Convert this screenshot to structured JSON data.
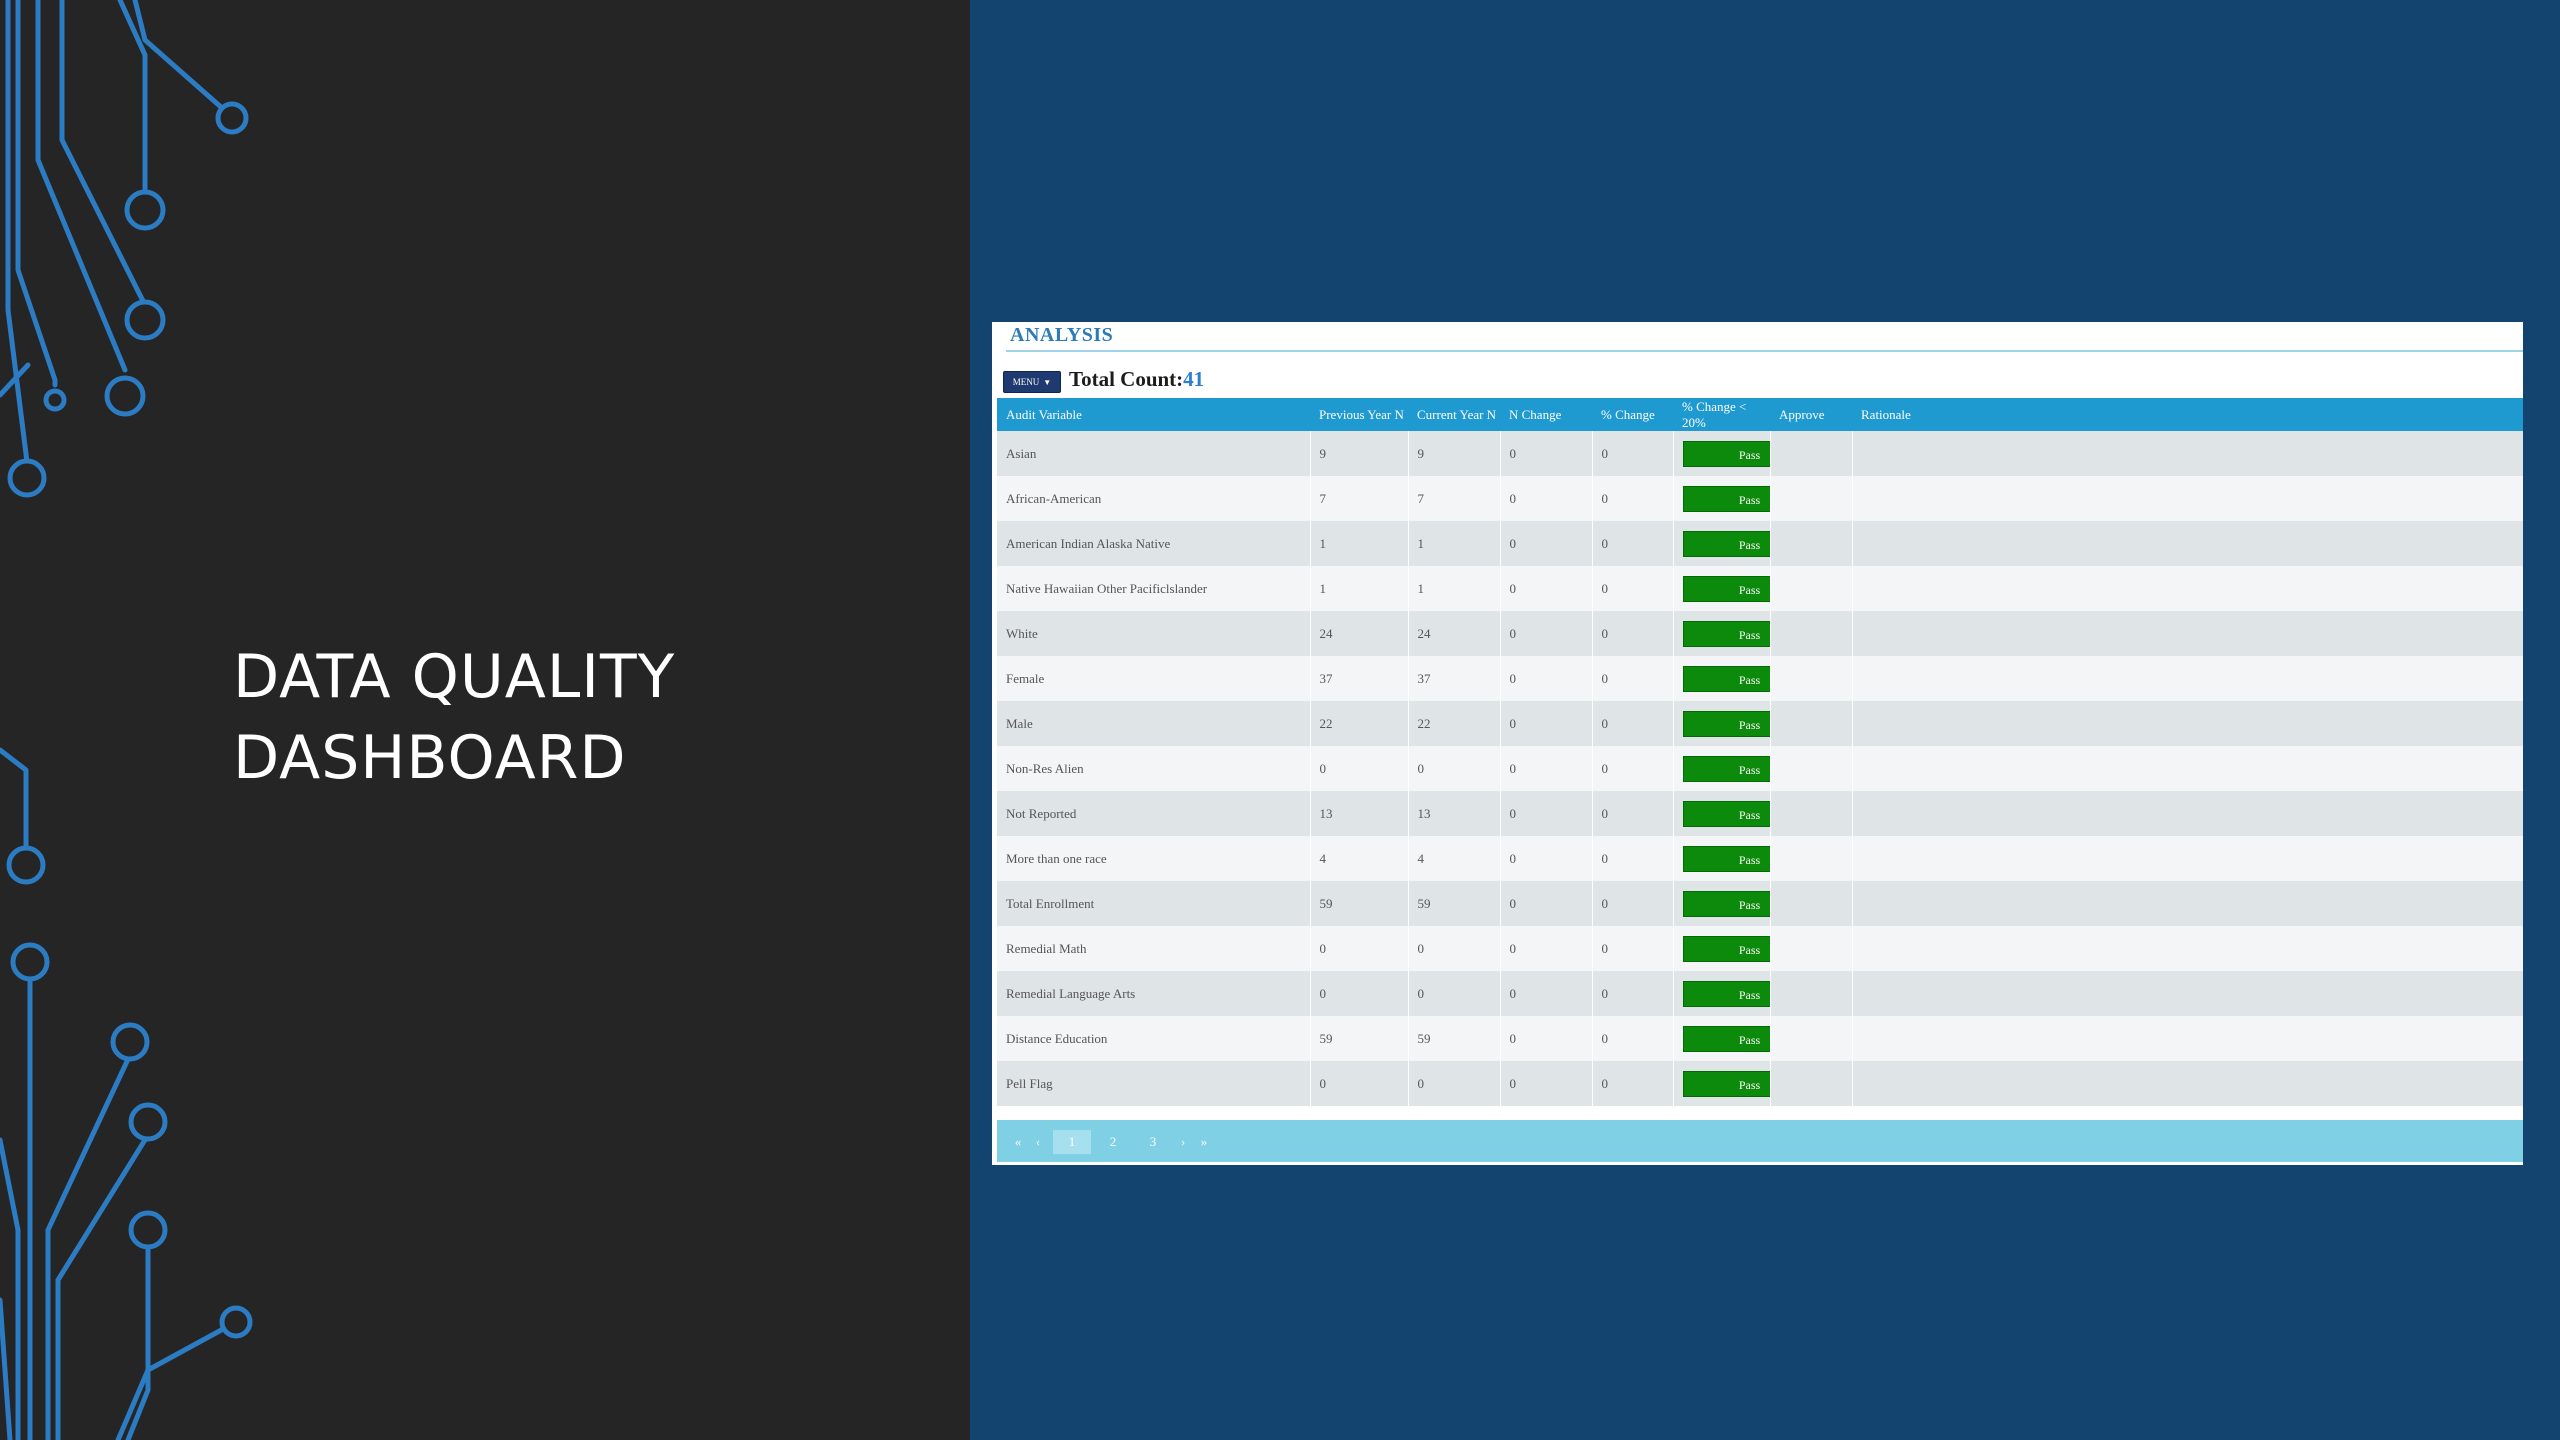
{
  "slide": {
    "title_line1": "DATA QUALITY",
    "title_line2": "DASHBOARD"
  },
  "colors": {
    "left_bg": "#252525",
    "right_bg": "#134470",
    "circuit": "#2c7cc4",
    "table_header": "#1f9ad0",
    "pass": "#0b8a0b",
    "pager": "#7fd0e4"
  },
  "panel": {
    "header": "ANALYSIS",
    "menu_label": "MENU",
    "total_count_label": "Total Count:",
    "total_count_value": "41"
  },
  "table": {
    "columns": [
      "Audit Variable",
      "Previous Year N",
      "Current Year N",
      "N Change",
      "% Change",
      "% Change < 20%",
      "Approve",
      "Rationale"
    ],
    "rows": [
      {
        "variable": "Asian",
        "prev": "9",
        "curr": "9",
        "n_change": "0",
        "pct_change": "0",
        "status": "Pass",
        "approve": "",
        "rationale": ""
      },
      {
        "variable": "African-American",
        "prev": "7",
        "curr": "7",
        "n_change": "0",
        "pct_change": "0",
        "status": "Pass",
        "approve": "",
        "rationale": ""
      },
      {
        "variable": "American Indian Alaska Native",
        "prev": "1",
        "curr": "1",
        "n_change": "0",
        "pct_change": "0",
        "status": "Pass",
        "approve": "",
        "rationale": ""
      },
      {
        "variable": "Native Hawaiian Other Pacificlslander",
        "prev": "1",
        "curr": "1",
        "n_change": "0",
        "pct_change": "0",
        "status": "Pass",
        "approve": "",
        "rationale": ""
      },
      {
        "variable": "White",
        "prev": "24",
        "curr": "24",
        "n_change": "0",
        "pct_change": "0",
        "status": "Pass",
        "approve": "",
        "rationale": ""
      },
      {
        "variable": "Female",
        "prev": "37",
        "curr": "37",
        "n_change": "0",
        "pct_change": "0",
        "status": "Pass",
        "approve": "",
        "rationale": ""
      },
      {
        "variable": "Male",
        "prev": "22",
        "curr": "22",
        "n_change": "0",
        "pct_change": "0",
        "status": "Pass",
        "approve": "",
        "rationale": ""
      },
      {
        "variable": "Non-Res Alien",
        "prev": "0",
        "curr": "0",
        "n_change": "0",
        "pct_change": "0",
        "status": "Pass",
        "approve": "",
        "rationale": ""
      },
      {
        "variable": "Not Reported",
        "prev": "13",
        "curr": "13",
        "n_change": "0",
        "pct_change": "0",
        "status": "Pass",
        "approve": "",
        "rationale": ""
      },
      {
        "variable": "More than one race",
        "prev": "4",
        "curr": "4",
        "n_change": "0",
        "pct_change": "0",
        "status": "Pass",
        "approve": "",
        "rationale": ""
      },
      {
        "variable": "Total Enrollment",
        "prev": "59",
        "curr": "59",
        "n_change": "0",
        "pct_change": "0",
        "status": "Pass",
        "approve": "",
        "rationale": ""
      },
      {
        "variable": "Remedial Math",
        "prev": "0",
        "curr": "0",
        "n_change": "0",
        "pct_change": "0",
        "status": "Pass",
        "approve": "",
        "rationale": ""
      },
      {
        "variable": "Remedial Language Arts",
        "prev": "0",
        "curr": "0",
        "n_change": "0",
        "pct_change": "0",
        "status": "Pass",
        "approve": "",
        "rationale": ""
      },
      {
        "variable": "Distance Education",
        "prev": "59",
        "curr": "59",
        "n_change": "0",
        "pct_change": "0",
        "status": "Pass",
        "approve": "",
        "rationale": ""
      },
      {
        "variable": "Pell Flag",
        "prev": "0",
        "curr": "0",
        "n_change": "0",
        "pct_change": "0",
        "status": "Pass",
        "approve": "",
        "rationale": ""
      }
    ]
  },
  "pager": {
    "first": "«",
    "prev": "‹",
    "pages": [
      "1",
      "2",
      "3"
    ],
    "current_page": "1",
    "next": "›",
    "last": "»"
  }
}
